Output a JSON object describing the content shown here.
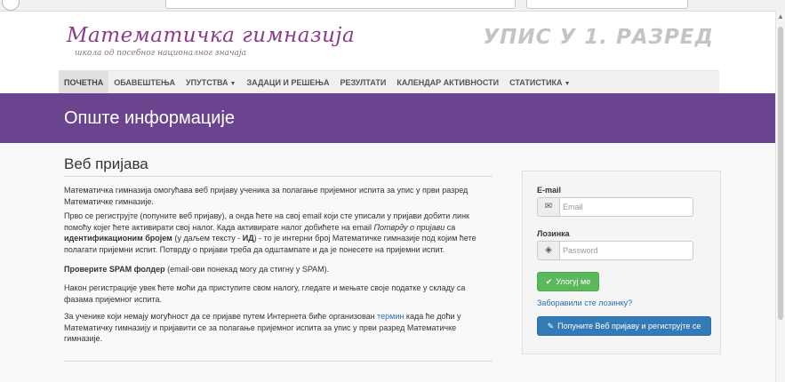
{
  "header": {
    "logo_title": "Математичка гимназија",
    "logo_subtitle": "школа од посебног националног значаја",
    "enroll_title": "УПИС У 1. РАЗРЕД"
  },
  "nav": {
    "items": [
      {
        "label": "ПОЧЕТНА"
      },
      {
        "label": "ОБАВЕШТЕЊА"
      },
      {
        "label": "УПУТСТВА"
      },
      {
        "label": "ЗАДАЦИ И РЕШЕЊА"
      },
      {
        "label": "РЕЗУЛТАТИ"
      },
      {
        "label": "КАЛЕНДАР АКТИВНОСТИ"
      },
      {
        "label": "СТАТИСТИКА"
      }
    ]
  },
  "banner": {
    "title": "Опште информације"
  },
  "main": {
    "title": "Веб пријава",
    "p1": "Математичка гимназија омогућава веб пријаву ученика за полагање пријемног испита за упис у први разред Математичке гимназије.",
    "p2_a": "Прво се региструјте (попуните веб пријаву), а онда ћете на свој email који сте уписали у пријави добити линк помоћу којег ћете активирати свој налог. Када активирате налог добићете на email ",
    "p2_i": "Потврду о пријави",
    "p2_b": " са ",
    "p2_bold1": "идентификационим бројем",
    "p2_c": " (у даљем тексту - ",
    "p2_bold2": "ИД",
    "p2_d": ") - то је интерни број Математичке гимназије под којим ћете полагати пријемни испит. Потврду о пријави треба да одштампате и да је понесете на пријемни испит.",
    "p3_bold": "Проверите SPAM фолдер",
    "p3_rest": " (email-ови понекад могу да стигну у SPAM).",
    "p4": "Након регистрације увек ћете моћи да приступите свом налогу, гледате и мењате своје податке у складу са фазама пријемног испита.",
    "p5_a": "За ученике који немају могућност да се пријаве путем Интернета биће организован ",
    "p5_link": "термин",
    "p5_b": " када ће доћи у Математичку гимназију и пријавити се за полагање пријемног испита за упис у први разред Математичке гимназије."
  },
  "login": {
    "email_label": "E-mail",
    "email_placeholder": "Email",
    "password_label": "Лозинка",
    "password_placeholder": "Password",
    "login_button": "Улогуј ме",
    "forgot_link": "Заборавили сте лозинку?",
    "register_button": "Попуните Веб пријаву и региструјте се"
  },
  "colors": {
    "banner": "#6b4490",
    "logo": "#8a3c86",
    "login_button": "#5cb85c",
    "register_button": "#337ab7",
    "link": "#2a6fb0"
  },
  "icons": {
    "email": "envelope-icon",
    "password": "eye-icon",
    "login": "check-icon",
    "register": "pencil-icon"
  }
}
